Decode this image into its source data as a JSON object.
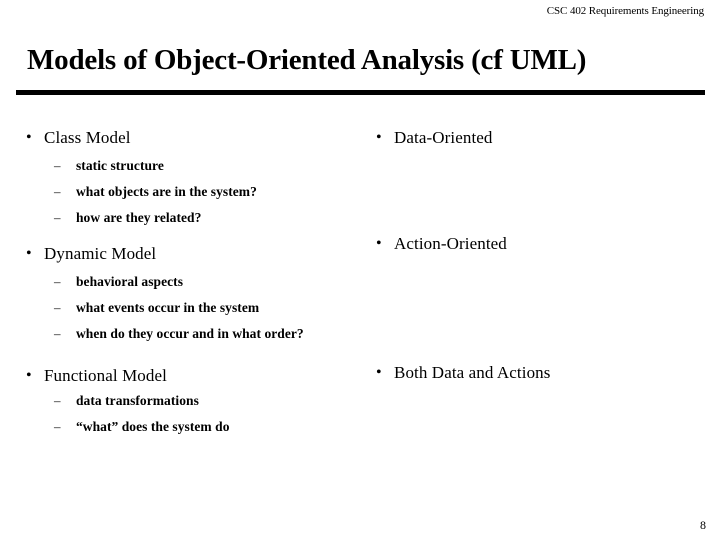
{
  "slide": {
    "header": "CSC 402 Requirements Engineering",
    "title": "Models of Object-Oriented Analysis (cf UML)",
    "page_number": "8",
    "bullet_marker": "•",
    "sub_marker": "–",
    "text_color": "#000000",
    "background_color": "#ffffff"
  },
  "left_column": {
    "groups": [
      {
        "heading": "Class Model",
        "sub_items": [
          "static structure",
          "what objects are in the system?",
          "how are they related?"
        ]
      },
      {
        "heading": "Dynamic Model",
        "sub_items": [
          "behavioral aspects",
          "what events occur in the system",
          "when do they occur and in what order?"
        ]
      },
      {
        "heading": "Functional Model",
        "sub_items": [
          "data transformations",
          "“what” does the system do"
        ]
      }
    ]
  },
  "right_column": {
    "items": [
      "Data-Oriented",
      "Action-Oriented",
      "Both Data and Actions"
    ]
  }
}
